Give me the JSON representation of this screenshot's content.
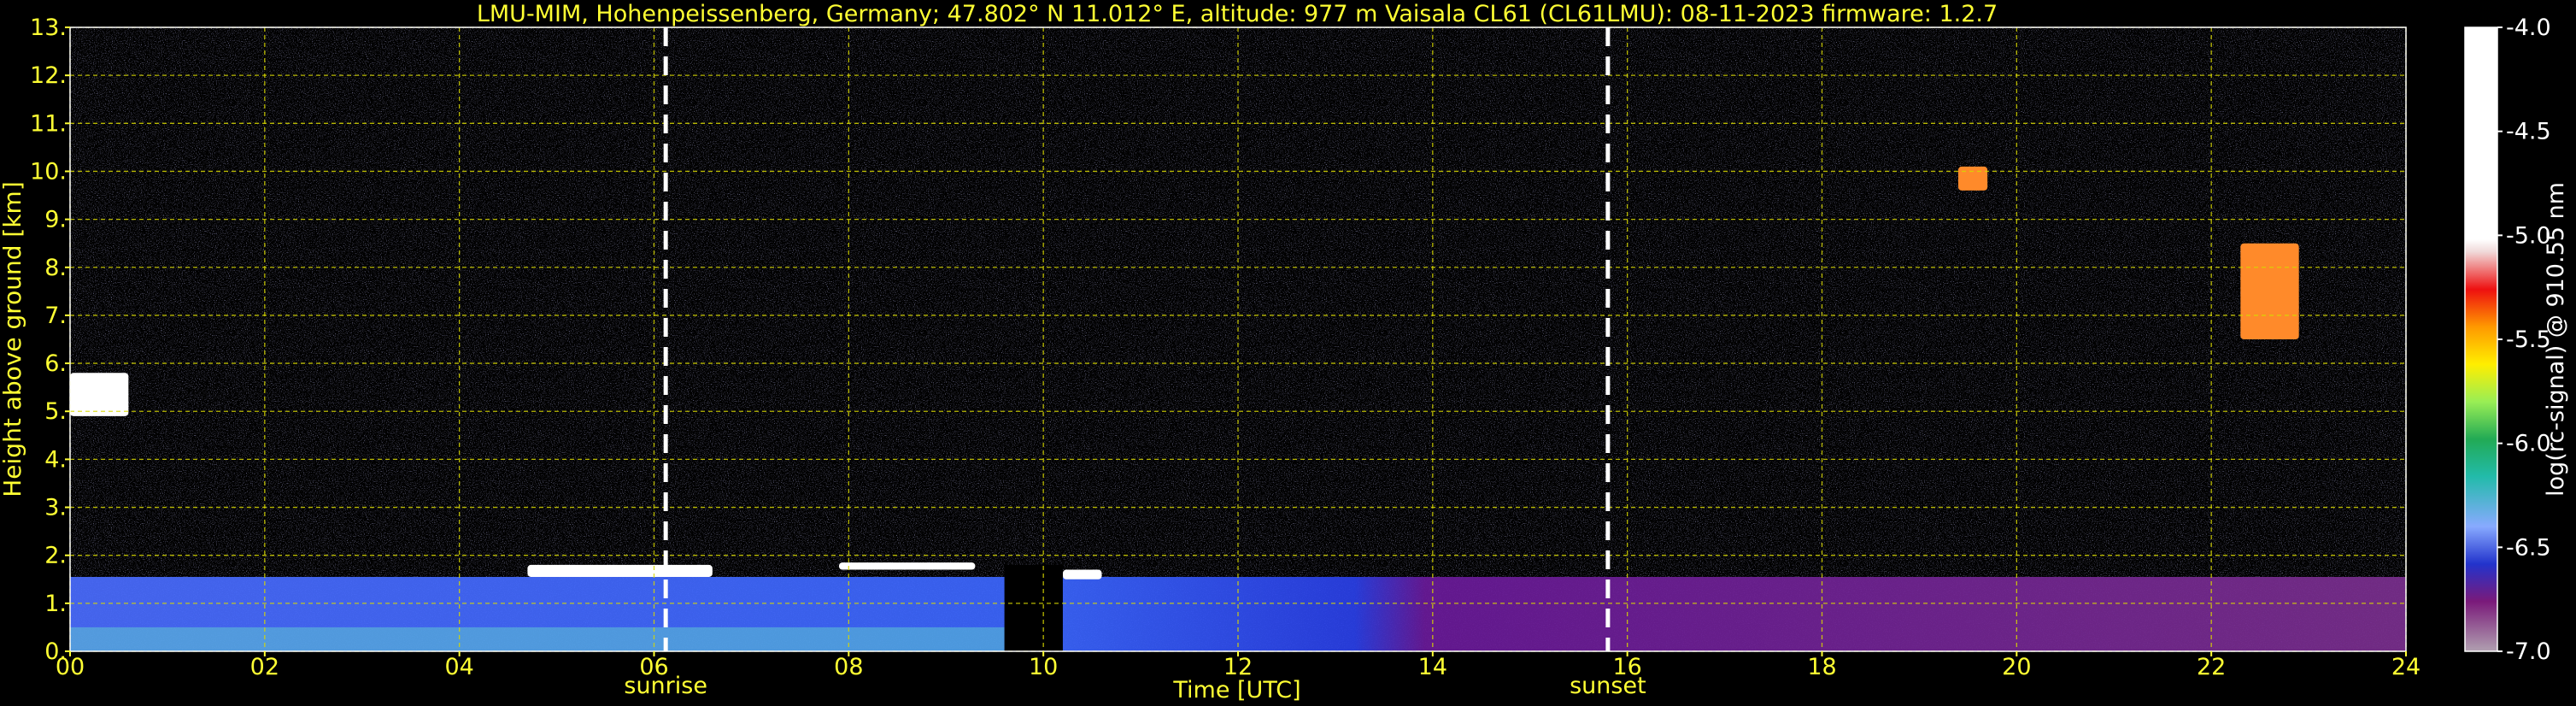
{
  "chart_data": {
    "type": "heatmap",
    "title": "LMU-MIM, Hohenpeissenberg, Germany; 47.802° N 11.012° E, altitude: 977 m    Vaisala CL61 (CL61LMU): 08-11-2023    firmware: 1.2.7",
    "xlabel": "Time [UTC]",
    "ylabel": "Height above ground [km]",
    "xlim": [
      0,
      24
    ],
    "ylim": [
      0,
      13
    ],
    "xticks": [
      "00",
      "02",
      "04",
      "06",
      "08",
      "10",
      "12",
      "14",
      "16",
      "18",
      "20",
      "22",
      "24"
    ],
    "yticks": [
      "0.",
      "1.",
      "2.",
      "3.",
      "4.",
      "5.",
      "6.",
      "7.",
      "8.",
      "9.",
      "10.",
      "11.",
      "12.",
      "13."
    ],
    "grid": true,
    "markers": [
      {
        "label": "sunrise",
        "x": 6.12
      },
      {
        "label": "sunset",
        "x": 15.8
      }
    ],
    "colorbar": {
      "label": "log(rc-signal) @ 910.55 nm",
      "range": [
        -7.0,
        -4.0
      ],
      "ticks": [
        "-4.0",
        "-4.5",
        "-5.0",
        "-5.5",
        "-6.0",
        "-6.5",
        "-7.0"
      ]
    },
    "data_gaps": [
      [
        9.6,
        10.2
      ]
    ],
    "features": [
      {
        "kind": "boundary-layer aerosol",
        "x": [
          0,
          24
        ],
        "top_km": [
          1.3,
          1.8
        ]
      },
      {
        "kind": "cloud",
        "x": [
          0.0,
          0.6
        ],
        "height_km": [
          4.9,
          5.8
        ]
      },
      {
        "kind": "cloud",
        "x": [
          4.7,
          6.6
        ],
        "height_km": [
          1.55,
          1.8
        ]
      },
      {
        "kind": "cloud",
        "x": [
          7.9,
          9.3
        ],
        "height_km": [
          1.7,
          1.85
        ]
      },
      {
        "kind": "cloud",
        "x": [
          10.2,
          10.6
        ],
        "height_km": [
          1.5,
          1.7
        ]
      },
      {
        "kind": "cirrus",
        "x": [
          19.4,
          19.7
        ],
        "height_km": [
          9.6,
          10.1
        ]
      },
      {
        "kind": "cirrus",
        "x": [
          22.3,
          22.9
        ],
        "height_km": [
          6.5,
          8.5
        ]
      }
    ],
    "colors": {
      "text": "#ffff33",
      "grid": "#d8d800",
      "background": "#000000",
      "marker": "#ffffff"
    }
  }
}
